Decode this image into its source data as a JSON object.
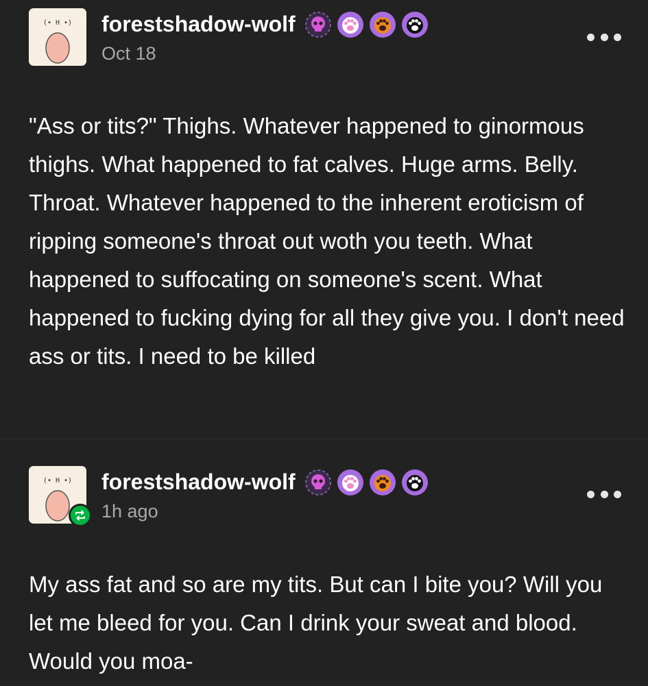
{
  "posts": [
    {
      "username": "forestshadow-wolf",
      "timestamp": "Oct 18",
      "avatar_text": "(• H •)",
      "badges": [
        "skull-badge-icon",
        "pink-paw-badge-icon",
        "orange-paw-badge-icon",
        "black-paw-badge-icon"
      ],
      "body": "\"Ass or tits?\" Thighs. Whatever happened to ginormous thighs. What happened to fat calves. Huge arms. Belly. Throat. Whatever happened to the inherent eroticism of ripping someone's throat out woth you teeth. What happened to suffocating on someone's scent. What happened to fucking dying for all they give you. I don't need ass or tits. I need to be killed"
    },
    {
      "username": "forestshadow-wolf",
      "timestamp": "1h ago",
      "avatar_text": "(• H •)",
      "reblogged": true,
      "badges": [
        "skull-badge-icon",
        "pink-paw-badge-icon",
        "orange-paw-badge-icon",
        "black-paw-badge-icon"
      ],
      "body": "My ass fat and so are my tits. But can I bite you? Will you let me bleed for you. Can I drink your sweat and blood. Would you moa-"
    }
  ],
  "colors": {
    "background": "#222222",
    "text": "#ffffff",
    "muted": "#a9a9a9",
    "reblog": "#00b441",
    "badge_purple": "#9b59d9"
  }
}
